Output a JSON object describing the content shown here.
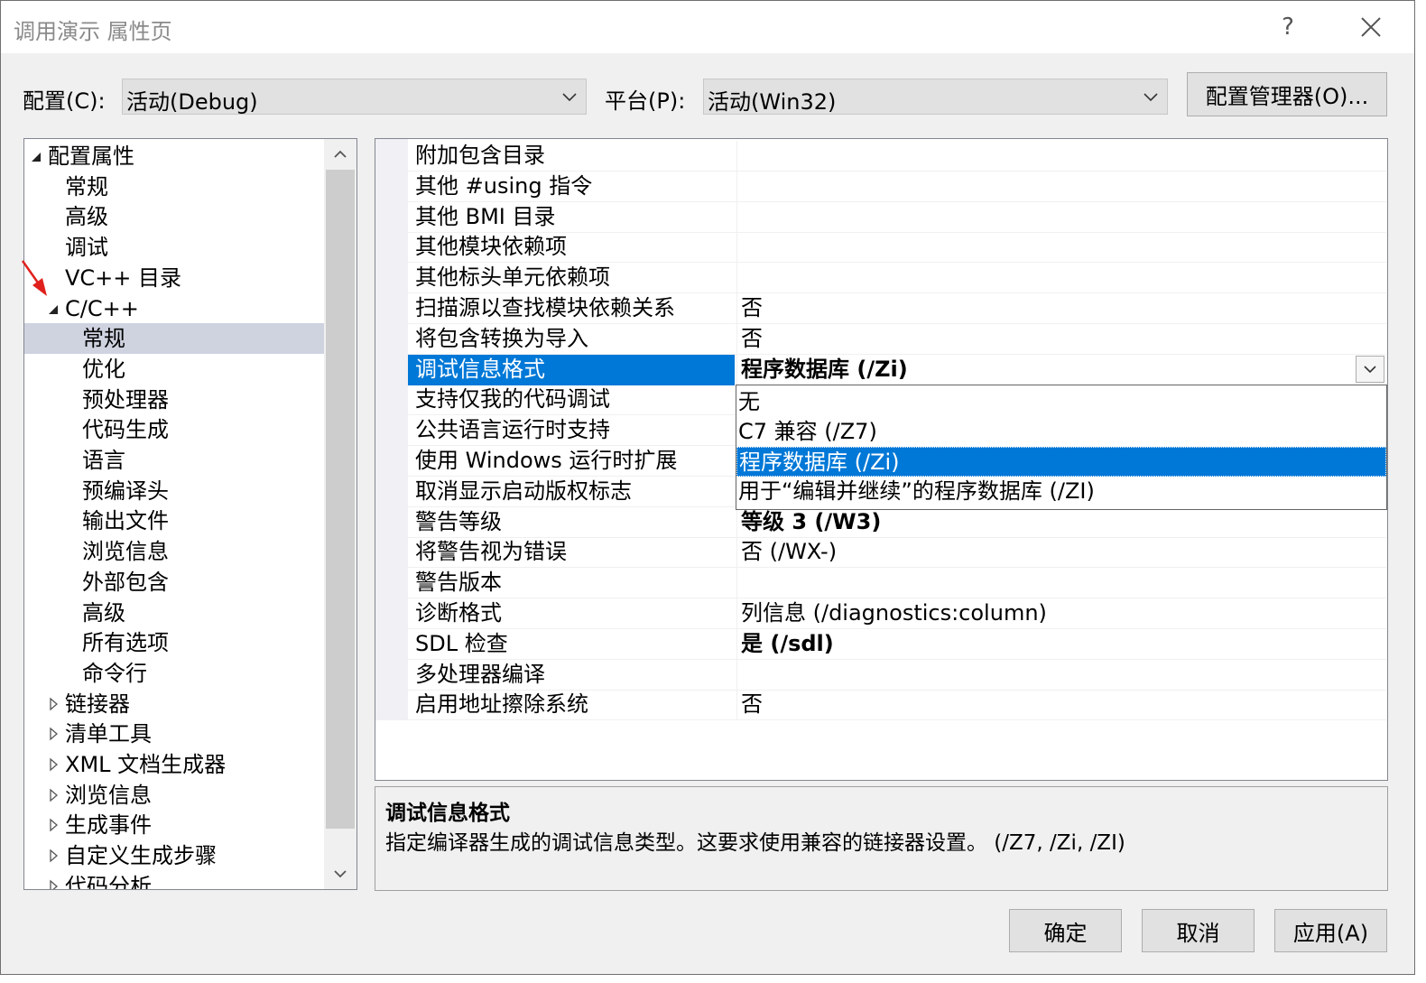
{
  "window": {
    "title": "调用演示 属性页",
    "help": "?",
    "close": "✕"
  },
  "config": {
    "label": "配置(C):",
    "value": "活动(Debug)"
  },
  "platform": {
    "label": "平台(P):",
    "value": "活动(Win32)"
  },
  "manager_button": "配置管理器(O)...",
  "tree": {
    "items": [
      {
        "label": "配置属性",
        "level": 0,
        "toggle": "expanded"
      },
      {
        "label": "常规",
        "level": 1,
        "toggle": "none"
      },
      {
        "label": "高级",
        "level": 1,
        "toggle": "none"
      },
      {
        "label": "调试",
        "level": 1,
        "toggle": "none"
      },
      {
        "label": "VC++ 目录",
        "level": 1,
        "toggle": "none"
      },
      {
        "label": "C/C++",
        "level": 1,
        "toggle": "expanded"
      },
      {
        "label": "常规",
        "level": 2,
        "toggle": "none",
        "selected": true
      },
      {
        "label": "优化",
        "level": 2,
        "toggle": "none"
      },
      {
        "label": "预处理器",
        "level": 2,
        "toggle": "none"
      },
      {
        "label": "代码生成",
        "level": 2,
        "toggle": "none"
      },
      {
        "label": "语言",
        "level": 2,
        "toggle": "none"
      },
      {
        "label": "预编译头",
        "level": 2,
        "toggle": "none"
      },
      {
        "label": "输出文件",
        "level": 2,
        "toggle": "none"
      },
      {
        "label": "浏览信息",
        "level": 2,
        "toggle": "none"
      },
      {
        "label": "外部包含",
        "level": 2,
        "toggle": "none"
      },
      {
        "label": "高级",
        "level": 2,
        "toggle": "none"
      },
      {
        "label": "所有选项",
        "level": 2,
        "toggle": "none"
      },
      {
        "label": "命令行",
        "level": 2,
        "toggle": "none"
      },
      {
        "label": "链接器",
        "level": 1,
        "toggle": "collapsed"
      },
      {
        "label": "清单工具",
        "level": 1,
        "toggle": "collapsed"
      },
      {
        "label": "XML 文档生成器",
        "level": 1,
        "toggle": "collapsed"
      },
      {
        "label": "浏览信息",
        "level": 1,
        "toggle": "collapsed"
      },
      {
        "label": "生成事件",
        "level": 1,
        "toggle": "collapsed"
      },
      {
        "label": "自定义生成步骤",
        "level": 1,
        "toggle": "collapsed"
      },
      {
        "label": "代码分析",
        "level": 1,
        "toggle": "collapsed"
      }
    ]
  },
  "properties": [
    {
      "name": "附加包含目录",
      "value": ""
    },
    {
      "name": "其他 #using 指令",
      "value": ""
    },
    {
      "name": "其他 BMI 目录",
      "value": ""
    },
    {
      "name": "其他模块依赖项",
      "value": ""
    },
    {
      "name": "其他标头单元依赖项",
      "value": ""
    },
    {
      "name": "扫描源以查找模块依赖关系",
      "value": "否"
    },
    {
      "name": "将包含转换为导入",
      "value": "否"
    },
    {
      "name": "调试信息格式",
      "value": "程序数据库 (/Zi)",
      "bold": true,
      "selected": true
    },
    {
      "name": "支持仅我的代码调试",
      "value": ""
    },
    {
      "name": "公共语言运行时支持",
      "value": ""
    },
    {
      "name": "使用 Windows 运行时扩展",
      "value": ""
    },
    {
      "name": "取消显示启动版权标志",
      "value": ""
    },
    {
      "name": "警告等级",
      "value": "等级 3 (/W3)",
      "bold": true
    },
    {
      "name": "将警告视为错误",
      "value": "否 (/WX-)"
    },
    {
      "name": "警告版本",
      "value": ""
    },
    {
      "name": "诊断格式",
      "value": "列信息 (/diagnostics:column)"
    },
    {
      "name": "SDL 检查",
      "value": "是 (/sdl)",
      "bold": true
    },
    {
      "name": "多处理器编译",
      "value": ""
    },
    {
      "name": "启用地址擦除系统",
      "value": "否"
    }
  ],
  "dropdown": {
    "options": [
      {
        "label": "无"
      },
      {
        "label": "C7 兼容 (/Z7)"
      },
      {
        "label": "程序数据库 (/Zi)",
        "selected": true
      },
      {
        "label": "用于“编辑并继续”的程序数据库 (/ZI)"
      }
    ]
  },
  "description": {
    "title": "调试信息格式",
    "text": "指定编译器生成的调试信息类型。这要求使用兼容的链接器设置。  (/Z7, /Zi, /ZI)"
  },
  "buttons": {
    "ok": "确定",
    "cancel": "取消",
    "apply": "应用(A)"
  },
  "colors": {
    "selection": "#0078d7",
    "tree_selection": "#cfd3e0",
    "annotation_arrow": "#e0201c"
  },
  "icons": {
    "expanded": "triangle-down-icon",
    "collapsed": "triangle-right-icon",
    "scroll_up": "chevron-up-icon",
    "scroll_down": "chevron-down-icon"
  }
}
